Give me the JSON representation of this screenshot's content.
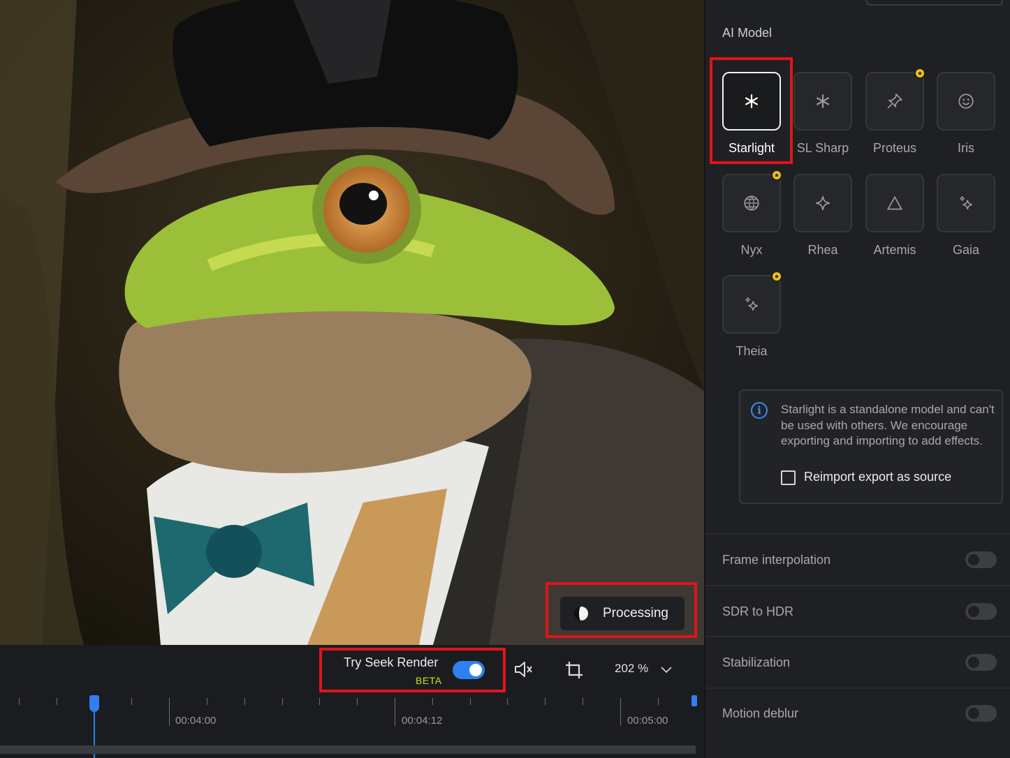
{
  "preview": {
    "status_label": "Processing"
  },
  "controls": {
    "seek_render_label": "Try Seek Render",
    "beta_label": "BETA",
    "seek_render_enabled": true,
    "zoom_value": "202 %"
  },
  "timeline": {
    "labels": [
      "00:04:00",
      "00:04:12",
      "00:05:00"
    ]
  },
  "sidebar": {
    "section_title": "AI Model",
    "models": [
      {
        "label": "Starlight",
        "icon": "asterisk-icon",
        "selected": true,
        "premium": false
      },
      {
        "label": "SL Sharp",
        "icon": "asterisk-icon",
        "selected": false,
        "premium": false
      },
      {
        "label": "Proteus",
        "icon": "pin-icon",
        "selected": false,
        "premium": true
      },
      {
        "label": "Iris",
        "icon": "smiley-icon",
        "selected": false,
        "premium": false
      },
      {
        "label": "Nyx",
        "icon": "globe-icon",
        "selected": false,
        "premium": true
      },
      {
        "label": "Rhea",
        "icon": "four-point-star-icon",
        "selected": false,
        "premium": false
      },
      {
        "label": "Artemis",
        "icon": "triangle-icon",
        "selected": false,
        "premium": false
      },
      {
        "label": "Gaia",
        "icon": "sparkles-icon",
        "selected": false,
        "premium": false
      },
      {
        "label": "Theia",
        "icon": "sparkles-icon",
        "selected": false,
        "premium": true
      }
    ],
    "info": {
      "text": "Starlight is a standalone model and can't be used with others. We encourage exporting and importing to add effects.",
      "checkbox_label": "Reimport export as source",
      "checkbox_checked": false
    },
    "features": [
      {
        "label": "Frame interpolation",
        "enabled": false
      },
      {
        "label": "SDR to HDR",
        "enabled": false
      },
      {
        "label": "Stabilization",
        "enabled": false
      },
      {
        "label": "Motion deblur",
        "enabled": false
      }
    ]
  },
  "colors": {
    "accent": "#2f7ff0",
    "highlight_box": "#e0141a",
    "beta": "#c4e21a",
    "premium_badge": "#f2c21a"
  }
}
